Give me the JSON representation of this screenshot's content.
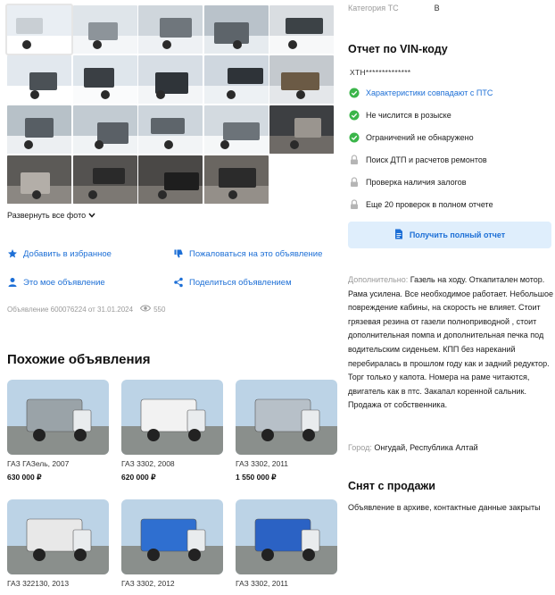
{
  "gallery": {
    "photos": [
      {
        "icon": "van-white-photo"
      },
      {
        "icon": "van-cab-photo"
      },
      {
        "icon": "truck-side-photo"
      },
      {
        "icon": "truck-rear-photo"
      },
      {
        "icon": "cabin-interior-photo"
      },
      {
        "icon": "wheel-snow-photo"
      },
      {
        "icon": "wheel-snow-photo"
      },
      {
        "icon": "wheel-snow-photo"
      },
      {
        "icon": "chassis-photo"
      },
      {
        "icon": "mud-wheel-photo"
      },
      {
        "icon": "door-photo"
      },
      {
        "icon": "flatbed-photo"
      },
      {
        "icon": "flatbed-photo"
      },
      {
        "icon": "truck-side-photo"
      },
      {
        "icon": "engine-photo"
      },
      {
        "icon": "wheel-hub-photo"
      },
      {
        "icon": "engine-photo"
      },
      {
        "icon": "engine-photo"
      },
      {
        "icon": "engine-photo"
      }
    ],
    "expand_label": "Развернуть все фото"
  },
  "actions": {
    "favorite": "Добавить в избранное",
    "complain": "Пожаловаться на это объявление",
    "my_ad": "Это мое объявление",
    "share": "Поделиться объявлением"
  },
  "meta": {
    "ad_info": "Объявление 600076224 от 31.01.2024",
    "views": "550"
  },
  "similar": {
    "title": "Похожие объявления",
    "cards": [
      {
        "name": "ГАЗ ГАЗель, 2007",
        "price": "630 000 ₽",
        "color": "#9aa3a8"
      },
      {
        "name": "ГАЗ 3302, 2008",
        "price": "620 000 ₽",
        "color": "#f2f2f2"
      },
      {
        "name": "ГАЗ 3302, 2011",
        "price": "1 550 000 ₽",
        "color": "#b7c0c8"
      },
      {
        "name": "ГАЗ 322130, 2013",
        "price": "",
        "color": "#e8e8e8"
      },
      {
        "name": "ГАЗ 3302, 2012",
        "price": "",
        "color": "#2f6fd0"
      },
      {
        "name": "ГАЗ 3302, 2011",
        "price": "",
        "color": "#2b62c4"
      }
    ]
  },
  "category": {
    "label": "Категория ТС",
    "value": "B"
  },
  "vin": {
    "title": "Отчет по VIN-коду",
    "code": "XTH**************",
    "checks": [
      {
        "text": "Характеристики совпадают с ПТС",
        "status": "ok-blue"
      },
      {
        "text": "Не числится в розыске",
        "status": "ok"
      },
      {
        "text": "Ограничений не обнаружено",
        "status": "ok"
      },
      {
        "text": "Поиск ДТП и расчетов ремонтов",
        "status": "lock"
      },
      {
        "text": "Проверка наличия залогов",
        "status": "lock"
      },
      {
        "text": "Еще 20 проверок в полном отчете",
        "status": "lock"
      }
    ],
    "button": "Получить полный отчет"
  },
  "description": {
    "label": "Дополнительно:",
    "text": "Газель на ходу. Откапитален мотор. Рама усилена. Все необходимое работает. Небольшое повреждение кабины, на скорость не влияет. Стоит грязевая резина от газели полноприводной , стоит дополнительная помпа и дополнительная печка под водительским сиденьем. КПП без нареканий перебиралась в прошлом году как и задний редуктор. Торг только у капота. Номера на раме читаются, двигатель как в птс. Закапал коренной сальник. Продажа от собственника."
  },
  "city": {
    "label": "Город:",
    "value": "Онгудай, Республика Алтай"
  },
  "removed": {
    "title": "Снят с продажи",
    "text": "Объявление в архиве, контактные данные закрыты"
  },
  "colors": {
    "accent": "#1d6fd6",
    "ok_green": "#3bb54a",
    "lock_gray": "#b5b5b5",
    "button_bg": "#dfeefc"
  }
}
